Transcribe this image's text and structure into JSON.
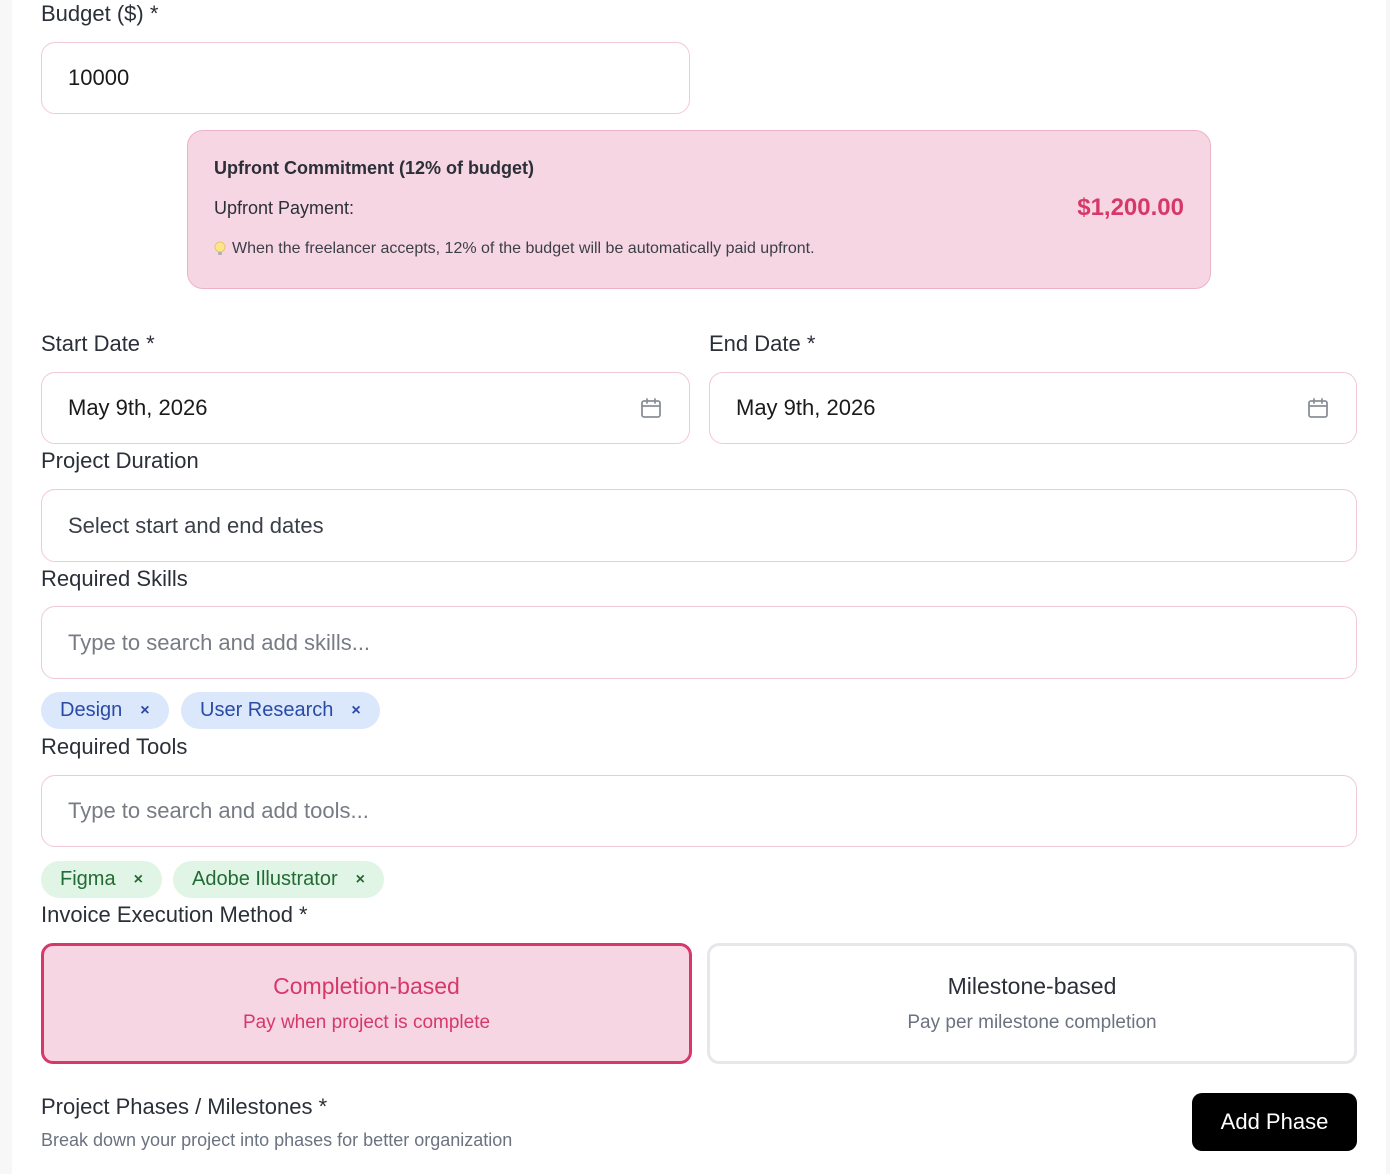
{
  "budget": {
    "label": "Budget ($) *",
    "value": "10000"
  },
  "upfront": {
    "title": "Upfront Commitment (12% of budget)",
    "payment_label": "Upfront Payment:",
    "payment_value": "$1,200.00",
    "note_icon": "lightbulb-icon",
    "note": "When the freelancer accepts, 12% of the budget will be automatically paid upfront."
  },
  "start_date": {
    "label": "Start Date *",
    "value": "May 9th, 2026",
    "icon": "calendar-icon"
  },
  "end_date": {
    "label": "End Date *",
    "value": "May 9th, 2026",
    "icon": "calendar-icon"
  },
  "duration": {
    "label": "Project Duration",
    "value": "Select start and end dates"
  },
  "skills": {
    "label": "Required Skills",
    "placeholder": "Type to search and add skills...",
    "tags": [
      "Design",
      "User Research"
    ],
    "remove_glyph": "×"
  },
  "tools": {
    "label": "Required Tools",
    "placeholder": "Type to search and add tools...",
    "tags": [
      "Figma",
      "Adobe Illustrator"
    ],
    "remove_glyph": "×"
  },
  "invoice": {
    "label": "Invoice Execution Method *",
    "options": [
      {
        "title": "Completion-based",
        "subtitle": "Pay when project is complete",
        "selected": true
      },
      {
        "title": "Milestone-based",
        "subtitle": "Pay per milestone completion",
        "selected": false
      }
    ]
  },
  "phases": {
    "label": "Project Phases / Milestones *",
    "description": "Break down your project into phases for better organization",
    "add_button": "Add Phase"
  },
  "colors": {
    "accent": "#d6386a",
    "info_bg": "#f6d6e2",
    "skill_chip_bg": "#dbe8fb",
    "tool_chip_bg": "#e0f5e6"
  }
}
